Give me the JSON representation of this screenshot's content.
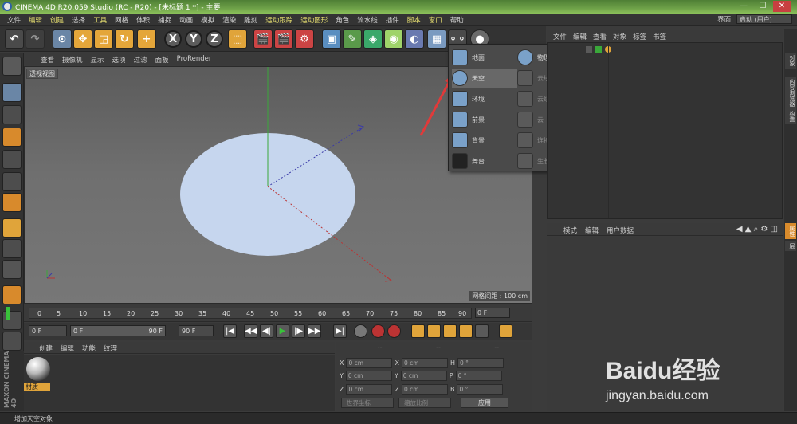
{
  "title_bar": {
    "title": "CINEMA 4D R20.059 Studio (RC - R20) - [未标题 1 *] - 主要",
    "minimize": "—",
    "maximize": "☐",
    "close": "✕"
  },
  "menu": {
    "items": [
      "文件",
      "编辑",
      "创建",
      "选择",
      "工具",
      "网格",
      "体积",
      "捕捉",
      "动画",
      "模拟",
      "渲染",
      "雕刻",
      "运动跟踪",
      "运动图形",
      "角色",
      "流水线",
      "插件",
      "脚本",
      "窗口",
      "帮助"
    ],
    "layout_label": "界面:",
    "layout_value": "启动 (用户)"
  },
  "viewport": {
    "menu": [
      "查看",
      "摄像机",
      "显示",
      "选项",
      "过滤",
      "面板",
      "ProRender"
    ],
    "label": "透视视图",
    "grid_spacing": "网格间距 : 100 cm"
  },
  "sky_popup": {
    "left": [
      {
        "label": "地面",
        "highlighted": false,
        "disabled": false
      },
      {
        "label": "天空",
        "highlighted": true,
        "disabled": false
      },
      {
        "label": "环境",
        "highlighted": false,
        "disabled": false
      },
      {
        "label": "前景",
        "highlighted": false,
        "disabled": false
      },
      {
        "label": "背景",
        "highlighted": false,
        "disabled": false
      },
      {
        "label": "舞台",
        "highlighted": false,
        "disabled": false
      }
    ],
    "right": [
      {
        "label": "物理天空",
        "disabled": false
      },
      {
        "label": "云绘制工具",
        "disabled": true
      },
      {
        "label": "云组",
        "disabled": true
      },
      {
        "label": "云",
        "disabled": true
      },
      {
        "label": "连接云",
        "disabled": true
      },
      {
        "label": "生长草坪",
        "disabled": true
      }
    ]
  },
  "object_manager": {
    "menu": [
      "文件",
      "编辑",
      "查看",
      "对象",
      "标签",
      "书签"
    ]
  },
  "attribute_manager": {
    "menu": [
      "模式",
      "编辑",
      "用户数据"
    ]
  },
  "side_tabs": [
    "对象",
    "内容浏览器",
    "构造",
    "属性",
    "层"
  ],
  "timeline": {
    "ticks": [
      "0",
      "5",
      "10",
      "15",
      "20",
      "25",
      "30",
      "35",
      "40",
      "45",
      "50",
      "55",
      "60",
      "65",
      "70",
      "75",
      "80",
      "85",
      "90"
    ],
    "current_frame": "0 F"
  },
  "transport": {
    "start": "0 F",
    "range_start": "0 F",
    "range_end": "90 F",
    "end": "90 F",
    "buttons": [
      "|◀",
      "◀◀",
      "◀|",
      "▶",
      "|▶",
      "▶▶",
      "▶|"
    ]
  },
  "material_manager": {
    "menu": [
      "创建",
      "编辑",
      "功能",
      "纹理"
    ],
    "material_name": "材质"
  },
  "coordinates": {
    "headers": [
      "--",
      "--",
      "--"
    ],
    "rows": [
      {
        "a": "X",
        "av": "0 cm",
        "b": "X",
        "bv": "0 cm",
        "c": "H",
        "cv": "0 °"
      },
      {
        "a": "Y",
        "av": "0 cm",
        "b": "Y",
        "bv": "0 cm",
        "c": "P",
        "cv": "0 °"
      },
      {
        "a": "Z",
        "av": "0 cm",
        "b": "Z",
        "bv": "0 cm",
        "c": "B",
        "cv": "0 °"
      }
    ],
    "world_mode": "世界坐标",
    "scale_mode": "缩放比例",
    "apply": "应用"
  },
  "status": "增加天空对象",
  "brand": {
    "maxon": "MAXON CINEMA 4D",
    "watermark": "Baidu经验",
    "watermark_url": "jingyan.baidu.com"
  },
  "colors": {
    "accent": "#e0a43a",
    "highlight": "#686868",
    "arrow": "#e03a3a"
  }
}
